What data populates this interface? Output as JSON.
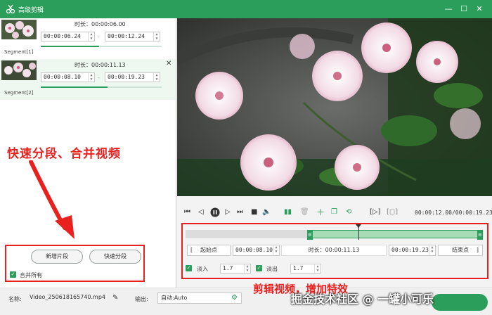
{
  "window": {
    "title": "高级剪辑",
    "icons": {
      "app": "scissors-logo-icon",
      "minimize": "minimize-icon",
      "maximize": "maximize-icon",
      "close": "close-icon"
    }
  },
  "segments": [
    {
      "label": "Segment[1]",
      "duration_label": "时长：00:00:06.00",
      "start": "00:00:06.24",
      "end": "00:00:12.24",
      "progress": 0.48
    },
    {
      "label": "Segment[2]",
      "duration_label": "时长：00:00:11.13",
      "start": "00:00:08.10",
      "end": "00:00:19.23",
      "progress": 0.55
    }
  ],
  "segment_dash": "-",
  "annotations": {
    "left": "快速分段、合并视频",
    "right": "剪辑视频，增加特效",
    "watermark": "掘金技术社区 @ 一罐小可乐"
  },
  "segment_actions": {
    "add_segment": "新增片段",
    "quick_split": "快速分段",
    "merge_all": "合并所有",
    "merge_all_checked": true
  },
  "player": {
    "timecode": "00:00:12.00/00:00:19.23",
    "icons": [
      "skip-start-icon",
      "step-back-icon",
      "pause-icon",
      "step-forward-icon",
      "skip-end-icon",
      "volume-icon",
      "split-icon",
      "delete-icon",
      "add-icon",
      "copy-icon",
      "rotate-icon",
      "crop-icon",
      "aspect-icon"
    ]
  },
  "trim": {
    "start_button": "起始点",
    "start_value": "00:00:08.10",
    "duration_label": "时长：00:00:11.13",
    "end_value": "00:00:19.23",
    "end_button": "结束点",
    "selection_start": 0.41,
    "selection_end": 1.0,
    "playhead": 0.58
  },
  "effects": {
    "fade_in_label": "淡入",
    "fade_in_value": "1.7",
    "fade_in_checked": true,
    "fade_out_label": "淡出",
    "fade_out_value": "1.7",
    "fade_out_checked": true
  },
  "footer": {
    "name_label": "名称:",
    "name_value": "Video_250618165740.mp4",
    "output_label": "输出:",
    "output_value": "自动:Auto"
  },
  "colors": {
    "accent": "#2c9e5b",
    "annotation": "#e8211f"
  }
}
